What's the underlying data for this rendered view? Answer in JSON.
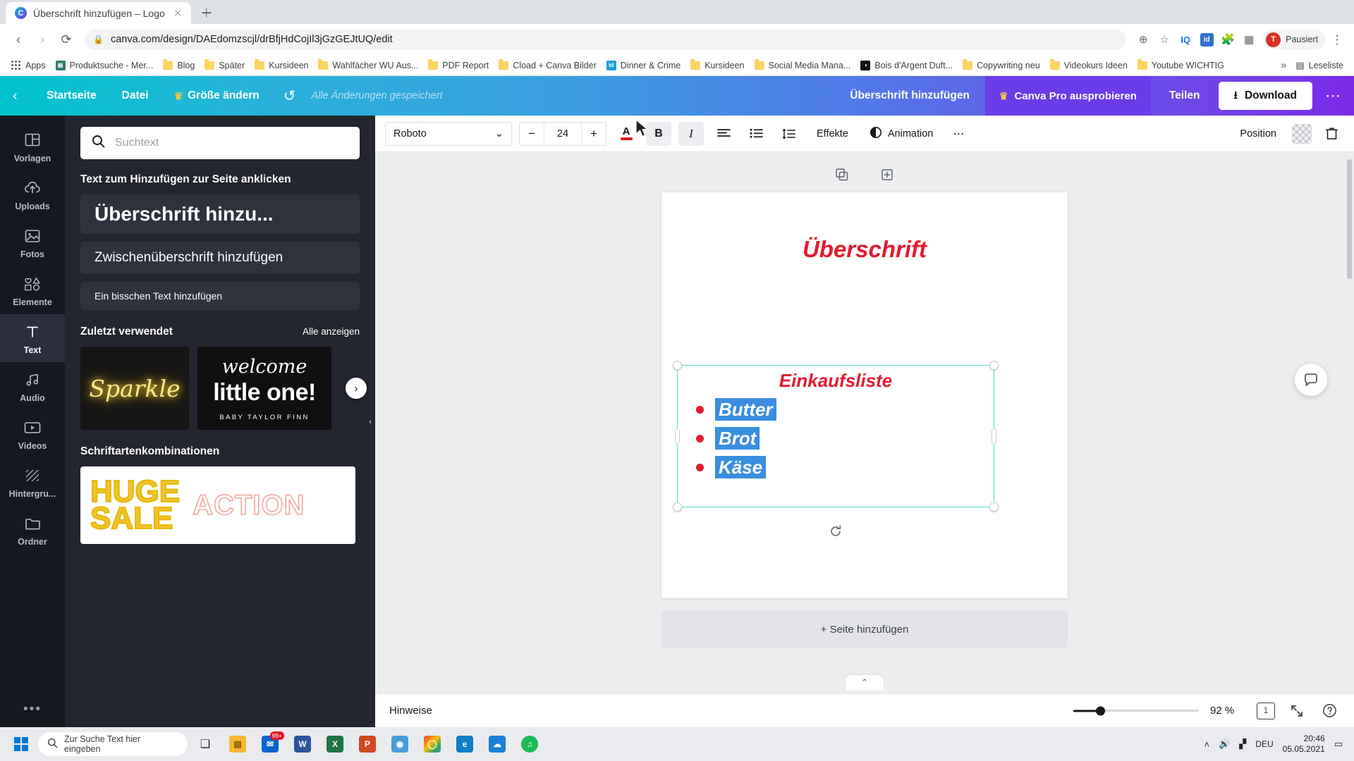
{
  "browser": {
    "tab": {
      "title": "Überschrift hinzufügen – Logo",
      "favicon": "C",
      "close_icon": "close-icon"
    },
    "new_tab_tooltip": "+",
    "nav": {
      "back": "‹",
      "forward": "›",
      "reload": "⟳"
    },
    "omnibox": {
      "lock_icon": "lock-icon",
      "url": "canva.com/design/DAEdomzscjl/drBfjHdCojIl3jGzGEJtUQ/edit"
    },
    "toolbar_icons": [
      "zoom-icon",
      "star-icon",
      "iq-extension",
      "id-extension",
      "puzzle-extension",
      "extension-icon"
    ],
    "profile": {
      "label": "Pausiert",
      "initial": "T"
    },
    "menu_icon": "kebab-menu-icon",
    "bookmarks": [
      {
        "label": "Apps",
        "icon": "apps-grid-icon"
      },
      {
        "label": "Produktsuche - Mer...",
        "icon": "site-icon",
        "color": "#2e7d6e"
      },
      {
        "label": "Blog",
        "icon": "folder-icon"
      },
      {
        "label": "Später",
        "icon": "folder-icon"
      },
      {
        "label": "Kursideen",
        "icon": "folder-icon"
      },
      {
        "label": "Wahlfächer WU Aus...",
        "icon": "folder-icon"
      },
      {
        "label": "PDF Report",
        "icon": "folder-icon"
      },
      {
        "label": "Cload + Canva Bilder",
        "icon": "folder-icon"
      },
      {
        "label": "Dinner & Crime",
        "icon": "site-icon",
        "color": "#1f9fd8",
        "glyph": "id"
      },
      {
        "label": "Kursideen",
        "icon": "folder-icon"
      },
      {
        "label": "Social Media Mana...",
        "icon": "folder-icon"
      },
      {
        "label": "Bois d'Argent Duft...",
        "icon": "site-icon",
        "color": "#111111",
        "glyph": "◑"
      },
      {
        "label": "Copywriting neu",
        "icon": "folder-icon"
      },
      {
        "label": "Videokurs Ideen",
        "icon": "folder-icon"
      },
      {
        "label": "Youtube WICHTIG",
        "icon": "folder-icon"
      }
    ],
    "bookmarks_overflow": "»",
    "reading_list": {
      "label": "Leseliste",
      "icon": "reading-list-icon"
    }
  },
  "canva_header": {
    "back_icon": "chevron-left-icon",
    "home": "Startseite",
    "file": "Datei",
    "resize": "Größe ändern",
    "resize_crown": "crown-icon",
    "undo_icon": "undo-icon",
    "saved_status": "Alle Änderungen gespeichert",
    "design_title": "Überschrift hinzufügen",
    "pro_button": "Canva Pro ausprobieren",
    "pro_crown": "crown-icon",
    "share": "Teilen",
    "download": "Download",
    "download_icon": "download-icon",
    "more_icon": "more-options-icon"
  },
  "sidebar": {
    "items": [
      {
        "label": "Vorlagen",
        "icon": "templates-icon",
        "active": false
      },
      {
        "label": "Uploads",
        "icon": "upload-cloud-icon",
        "active": false
      },
      {
        "label": "Fotos",
        "icon": "photo-icon",
        "active": false
      },
      {
        "label": "Elemente",
        "icon": "shapes-icon",
        "active": false
      },
      {
        "label": "Text",
        "icon": "text-icon",
        "active": true
      },
      {
        "label": "Audio",
        "icon": "music-note-icon",
        "active": false
      },
      {
        "label": "Videos",
        "icon": "video-icon",
        "active": false
      },
      {
        "label": "Hintergru...",
        "icon": "background-icon",
        "active": false
      },
      {
        "label": "Ordner",
        "icon": "folder-icon",
        "active": false
      }
    ],
    "more_icon": "more-dots-icon"
  },
  "text_panel": {
    "search_placeholder": "Suchtext",
    "search_value": "",
    "search_icon": "search-icon",
    "section_label": "Text zum Hinzufügen zur Seite anklicken",
    "chips": [
      "Überschrift hinzu...",
      "Zwischenüberschrift hinzufügen",
      "Ein bisschen Text hinzufügen"
    ],
    "recent_label": "Zuletzt verwendet",
    "recent_link": "Alle anzeigen",
    "recent_items": [
      {
        "name": "Sparkle",
        "text": "Sparkle"
      },
      {
        "name": "welcome little one",
        "line1": "welcome",
        "line2": "little one!",
        "line3": "BABY TAYLOR FINN"
      }
    ],
    "carousel_next_icon": "chevron-right-icon",
    "fontcombo_label": "Schriftartenkombinationen",
    "fontcombo_items": [
      {
        "line1": "HUGE",
        "line2": "SALE",
        "word": "ACTION"
      }
    ],
    "collapse_icon": "collapse-panel-icon"
  },
  "edit_toolbar": {
    "font_family": "Roboto",
    "font_dropdown_icon": "chevron-down-icon",
    "size_minus": "−",
    "font_size": "24",
    "size_plus": "+",
    "color_icon": "text-color-icon",
    "color_value": "#e02020",
    "bold": "B",
    "italic": "I",
    "align_icon": "align-left-icon",
    "list_icon": "bullet-list-icon",
    "spacing_icon": "line-spacing-icon",
    "effects": "Effekte",
    "animation": "Animation",
    "animation_icon": "animation-icon",
    "more_icon": "more-options-icon",
    "position": "Position",
    "transparency_icon": "transparency-icon",
    "delete_icon": "trash-icon"
  },
  "canvas": {
    "page_tools": {
      "duplicate_icon": "duplicate-page-icon",
      "add_icon": "add-page-icon"
    },
    "heading": "Überschrift",
    "selection": {
      "title": "Einkaufsliste",
      "items": [
        "Butter",
        "Brot",
        "Käse"
      ],
      "rotate_icon": "rotate-icon",
      "text_color": "#e31b2f",
      "selection_color": "#3a8ee0"
    },
    "comment_icon": "comment-icon",
    "add_page": "+ Seite hinzufügen",
    "collapse_icon": "chevron-up-icon"
  },
  "bottom_bar": {
    "notes": "Hinweise",
    "zoom_percent": "92 %",
    "page_number": "1",
    "fullscreen_icon": "expand-icon",
    "help_icon": "help-icon"
  },
  "taskbar": {
    "start_icon": "windows-start-icon",
    "search_placeholder": "Zur Suche Text hier eingeben",
    "search_icon": "search-icon",
    "apps": [
      {
        "name": "task-view",
        "glyph": "❏",
        "color": "transparent",
        "fg": "#1f1f1f"
      },
      {
        "name": "file-explorer",
        "glyph": "📁",
        "color": "#f7b731"
      },
      {
        "name": "mail",
        "glyph": "✉",
        "color": "#0b63ce",
        "badge": "99+"
      },
      {
        "name": "word",
        "glyph": "W",
        "color": "#2b579a"
      },
      {
        "name": "excel",
        "glyph": "X",
        "color": "#217346"
      },
      {
        "name": "powerpoint",
        "glyph": "P",
        "color": "#d24726"
      },
      {
        "name": "media-player",
        "glyph": "◉",
        "color": "#4a9ed8"
      },
      {
        "name": "chrome",
        "glyph": "◯",
        "color": "#4285f4"
      },
      {
        "name": "edge",
        "glyph": "e",
        "color": "#0f7ec4"
      },
      {
        "name": "onedrive",
        "glyph": "☁",
        "color": "#1a7fd4"
      },
      {
        "name": "spotify",
        "glyph": "♫",
        "color": "#1db954"
      }
    ],
    "tray": {
      "chevron": "˄",
      "volume_icon": "volume-icon",
      "network_icon": "network-icon",
      "language": "DEU"
    },
    "clock": {
      "time": "20:46",
      "date": "05.05.2021"
    },
    "notification_icon": "notifications-icon"
  }
}
